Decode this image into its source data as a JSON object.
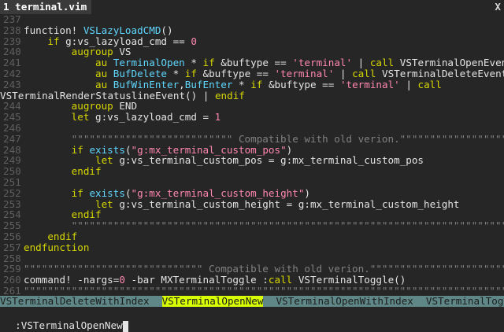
{
  "tabline": {
    "tab_label": "1 terminal.vim",
    "close": "X"
  },
  "buffer": {
    "lines": [
      {
        "n": "237",
        "text": ""
      },
      {
        "n": "238",
        "text": "function! VSLazyLoadCMD()"
      },
      {
        "n": "239",
        "text": "    if g:vs_lazyload_cmd == 0"
      },
      {
        "n": "240",
        "text": "        augroup VS"
      },
      {
        "n": "241",
        "text": "            au TerminalOpen * if &buftype == 'terminal' | call VSTerminalOpenEvent() | endif"
      },
      {
        "n": "242",
        "text": "            au BufDelete * if &buftype == 'terminal' | call VSTerminalDeleteEvent() | endif"
      },
      {
        "n": "243",
        "text": "            au BufWinEnter,BufEnter * if &buftype == 'terminal' | call"
      },
      {
        "n": "",
        "text": "VSTerminalRenderStatuslineEvent() | endif"
      },
      {
        "n": "244",
        "text": "        augroup END"
      },
      {
        "n": "245",
        "text": "        let g:vs_lazyload_cmd = 1"
      },
      {
        "n": "246",
        "text": ""
      },
      {
        "n": "247",
        "text": "        \"\"\"\"\"\"\"\"\"\"\"\"\"\"\"\"\"\"\"\"\"\"\"\"\"\"\" Compatible with old verion.\"\"\"\"\"\"\"\"\"\"\"\"\"\"\"\"\"\"\"\"\"\"\"\"\"\"\"\""
      },
      {
        "n": "248",
        "text": "        if exists(\"g:mx_terminal_custom_pos\")"
      },
      {
        "n": "249",
        "text": "            let g:vs_terminal_custom_pos = g:mx_terminal_custom_pos"
      },
      {
        "n": "250",
        "text": "        endif"
      },
      {
        "n": "251",
        "text": ""
      },
      {
        "n": "252",
        "text": "        if exists(\"g:mx_terminal_custom_height\")"
      },
      {
        "n": "253",
        "text": "            let g:vs_terminal_custom_height = g:mx_terminal_custom_height"
      },
      {
        "n": "254",
        "text": "        endif"
      },
      {
        "n": "255",
        "text": "        \"\"\"\"\"\"\"\"\"\"\"\"\"\"\"\"\"\"\"\"\"\"\"\"\"\"\"\"\"\"\"\"\"\"\"\"\"\"\"\"\"\"\"\"\"\"\"\"\"\"\"\"\"\"\"\"\"\"\"\"\"\"\"\"\"\"\"\"\"\"\"\"\"\"\"\"\"\"\"\"\""
      },
      {
        "n": "256",
        "text": "    endif"
      },
      {
        "n": "257",
        "text": "endfunction"
      },
      {
        "n": "258",
        "text": ""
      },
      {
        "n": "259",
        "text": "\"\"\"\"\"\"\"\"\"\"\"\"\"\"\"\"\"\"\"\"\"\"\"\"\"\"\"\"\"\" Compatible with old verion.\"\"\"\"\"\"\"\"\"\"\"\"\"\"\"\"\"\"\"\"\"\"\"\"\"\"\"\"\""
      },
      {
        "n": "260",
        "text": "command! -nargs=0 -bar MXTerminalToggle :call VSTerminalToggle()"
      },
      {
        "n": "261",
        "text": "\"\"\"\"\"\"\"\"\"\"\"\"\"\"\"\"\"\"\"\"\"\"\"\"\"\"\"\"\"\"\"\"\"\"\"\"\"\"\"\"\"\"\"\"\"\"\"\"\"\"\"\"\"\"\"\"\"\"\"\"\"\"\"\"\"\"\"\"\"\"\"\"\"\"\"\"\"\"\"\"\"\"\""
      }
    ]
  },
  "wildmenu": {
    "items": [
      {
        "label": "VSTerminalDeleteWithIndex",
        "selected": false
      },
      {
        "label": "VSTerminalOpenNew",
        "selected": true
      },
      {
        "label": "VSTerminalOpenWithIndex",
        "selected": false
      },
      {
        "label": "VSTerminalToggle",
        "selected": false
      }
    ]
  },
  "cmdline": {
    "text": ":VSTerminalOpenNew"
  },
  "colors": {
    "background": "#262626",
    "keyword": "#d7d700",
    "function": "#5fd7ff",
    "string": "#ff87af",
    "comment": "#808080",
    "wildmenu_bg": "#5f8787",
    "wildmenu_sel": "#d7ff00"
  }
}
